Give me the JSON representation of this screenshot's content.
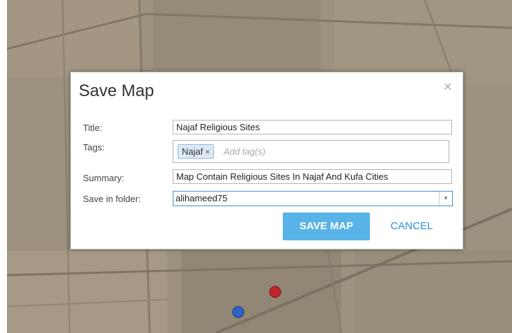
{
  "dialog": {
    "title": "Save Map",
    "close_symbol": "×",
    "title_label": "Title:",
    "title_value": "Najaf Religious Sites",
    "tags_label": "Tags:",
    "tags": [
      {
        "label": "Najaf",
        "remove_symbol": "×"
      }
    ],
    "tags_placeholder": "Add tag(s)",
    "summary_label": "Summary:",
    "summary_value": "Map Contain Religious Sites In Najaf And Kufa Cities",
    "folder_label": "Save in folder:",
    "folder_value": "alihameed75",
    "save_label": "SAVE MAP",
    "cancel_label": "CANCEL"
  },
  "colors": {
    "save_button": "#58b3e6",
    "cancel_text": "#2f8fd8",
    "marker_red": "#c0272d",
    "marker_blue": "#2f62c8"
  },
  "icons": [
    "close-icon",
    "chevron-down-icon",
    "red-marker-icon",
    "blue-marker-icon"
  ]
}
